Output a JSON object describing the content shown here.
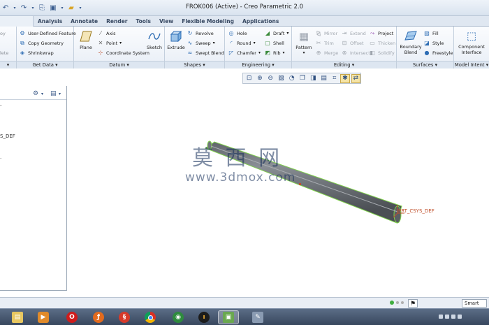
{
  "window": {
    "title": "FROK006 (Active) - Creo Parametric 2.0"
  },
  "tabs": [
    "",
    "Analysis",
    "Annotate",
    "Render",
    "Tools",
    "View",
    "Flexible Modeling",
    "Applications"
  ],
  "ribbon": {
    "left_partial": {
      "items": [
        "oy",
        "lete"
      ]
    },
    "get_data": {
      "label": "Get Data",
      "items": [
        "User-Defined Feature",
        "Copy Geometry",
        "Shrinkwrap"
      ]
    },
    "datum": {
      "label": "Datum",
      "plane": "Plane",
      "items": [
        "Axis",
        "Point",
        "Coordinate System"
      ],
      "sketch": "Sketch"
    },
    "shapes": {
      "label": "Shapes",
      "extrude": "Extrude",
      "items": [
        "Revolve",
        "Sweep",
        "Swept Blend"
      ]
    },
    "engineering": {
      "label": "Engineering",
      "col1": [
        "Hole",
        "Round",
        "Chamfer"
      ],
      "col2": [
        "Draft",
        "Shell",
        "Rib"
      ]
    },
    "editing": {
      "label": "Editing",
      "pattern": "Pattern",
      "col1": [
        "Mirror",
        "Trim",
        "Merge"
      ],
      "col2": [
        "Extend",
        "Offset",
        "Intersect"
      ],
      "col3": [
        "Project",
        "Thicken",
        "Solidify"
      ]
    },
    "surfaces": {
      "label": "Surfaces",
      "boundary_blend": [
        "Boundary",
        "Blend"
      ],
      "items": [
        "Fill",
        "Style",
        "Freestyle"
      ]
    },
    "model_intent": {
      "label": "Model Intent",
      "component_interface": [
        "Component",
        "Interface"
      ]
    }
  },
  "model_tree": {
    "items": [
      "S_DEF"
    ]
  },
  "viewport": {
    "csys_label": "PRT_CSYS_DEF",
    "watermark_cn": "莫 西 网",
    "watermark_url": "www.3dmox.com",
    "part_color": "#6f747a",
    "edge_color": "#7fd14a",
    "csys_color": "#c0502c"
  },
  "statusbar": {
    "filter": "Smart",
    "dot_colors": [
      "#3fae3f",
      "#b0b0b0",
      "#b0b0b0"
    ]
  },
  "taskbar": {
    "apps": [
      "explorer-icon",
      "media-player-icon",
      "opera-icon",
      "firefox-icon",
      "app-icon",
      "chrome-icon",
      "globe-icon",
      "winamp-icon",
      "creo-icon",
      "tool-icon"
    ]
  }
}
